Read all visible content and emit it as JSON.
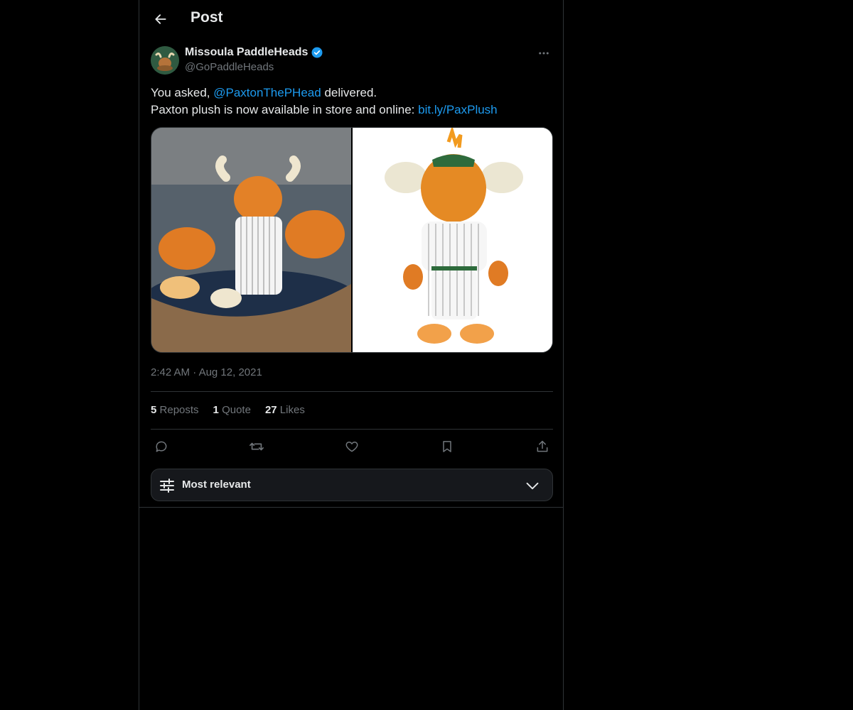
{
  "header": {
    "title": "Post"
  },
  "author": {
    "name": "Missoula PaddleHeads",
    "handle": "@GoPaddleHeads"
  },
  "post": {
    "text_1_prefix": "You asked,",
    "text_1_mention": "@PaxtonThePHead",
    "text_1_suffix": "delivered.",
    "text_2_prefix": "Paxton plush is now available in store and online:",
    "text_2_link": "bit.ly/PaxPlush",
    "time": "2:42 AM",
    "separator": "·",
    "date": "Aug 12, 2021"
  },
  "stats": {
    "reposts_count": "5",
    "reposts_label": "Reposts",
    "quotes_count": "1",
    "quotes_label": "Quote",
    "likes_count": "27",
    "likes_label": "Likes"
  },
  "sort": {
    "label": "Most relevant"
  },
  "icons": {
    "back": "arrow-left-icon",
    "verified": "verified-badge-icon",
    "more": "more-horizontal-icon",
    "reply": "reply-icon",
    "repost": "repost-icon",
    "like": "heart-icon",
    "bookmark": "bookmark-icon",
    "share": "share-icon",
    "sort": "sliders-icon",
    "chevron": "chevron-down-icon"
  },
  "colors": {
    "background": "#000000",
    "text": "#e7e9ea",
    "muted": "#71767b",
    "accent": "#1d9bf0",
    "border": "#2f3336"
  }
}
